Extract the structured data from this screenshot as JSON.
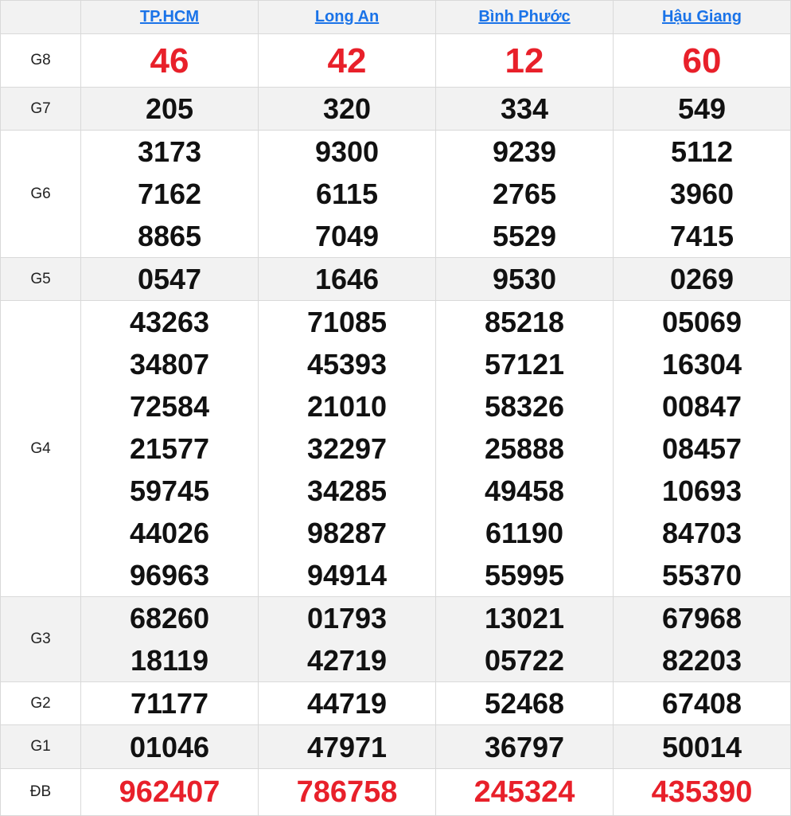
{
  "provinces": [
    "TP.HCM",
    "Long An",
    "Bình Phước",
    "Hậu Giang"
  ],
  "colors": {
    "link": "#1a73e8",
    "special": "#e8202a",
    "header_bg": "#f2f2f2",
    "border": "#d9d9d9"
  },
  "rows": {
    "g8": {
      "label": "G8",
      "values": [
        [
          "46"
        ],
        [
          "42"
        ],
        [
          "12"
        ],
        [
          "60"
        ]
      ]
    },
    "g7": {
      "label": "G7",
      "values": [
        [
          "205"
        ],
        [
          "320"
        ],
        [
          "334"
        ],
        [
          "549"
        ]
      ]
    },
    "g6": {
      "label": "G6",
      "values": [
        [
          "3173",
          "7162",
          "8865"
        ],
        [
          "9300",
          "6115",
          "7049"
        ],
        [
          "9239",
          "2765",
          "5529"
        ],
        [
          "5112",
          "3960",
          "7415"
        ]
      ]
    },
    "g5": {
      "label": "G5",
      "values": [
        [
          "0547"
        ],
        [
          "1646"
        ],
        [
          "9530"
        ],
        [
          "0269"
        ]
      ]
    },
    "g4": {
      "label": "G4",
      "values": [
        [
          "43263",
          "34807",
          "72584",
          "21577",
          "59745",
          "44026",
          "96963"
        ],
        [
          "71085",
          "45393",
          "21010",
          "32297",
          "34285",
          "98287",
          "94914"
        ],
        [
          "85218",
          "57121",
          "58326",
          "25888",
          "49458",
          "61190",
          "55995"
        ],
        [
          "05069",
          "16304",
          "00847",
          "08457",
          "10693",
          "84703",
          "55370"
        ]
      ]
    },
    "g3": {
      "label": "G3",
      "values": [
        [
          "68260",
          "18119"
        ],
        [
          "01793",
          "42719"
        ],
        [
          "13021",
          "05722"
        ],
        [
          "67968",
          "82203"
        ]
      ]
    },
    "g2": {
      "label": "G2",
      "values": [
        [
          "71177"
        ],
        [
          "44719"
        ],
        [
          "52468"
        ],
        [
          "67408"
        ]
      ]
    },
    "g1": {
      "label": "G1",
      "values": [
        [
          "01046"
        ],
        [
          "47971"
        ],
        [
          "36797"
        ],
        [
          "50014"
        ]
      ]
    },
    "db": {
      "label": "ĐB",
      "values": [
        [
          "962407"
        ],
        [
          "786758"
        ],
        [
          "245324"
        ],
        [
          "435390"
        ]
      ]
    }
  }
}
